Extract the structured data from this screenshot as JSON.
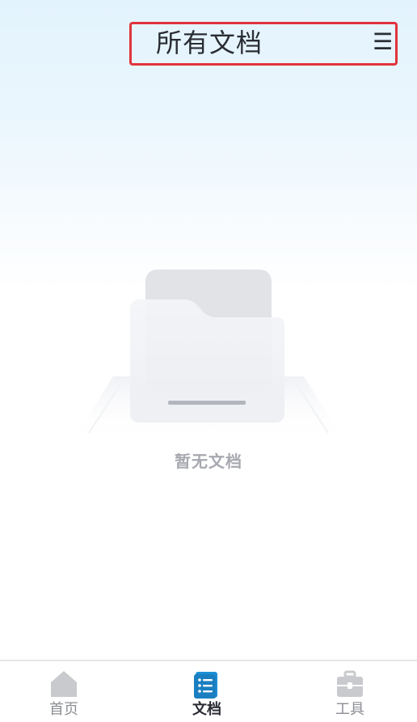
{
  "header": {
    "title": "所有文档",
    "menu_glyph": "☰"
  },
  "empty_state": {
    "message": "暂无文档",
    "icon": "empty-folder-icon"
  },
  "tabbar": {
    "tabs": [
      {
        "label": "首页",
        "icon": "home-icon",
        "active": false
      },
      {
        "label": "文档",
        "icon": "document-list-icon",
        "active": true
      },
      {
        "label": "工具",
        "icon": "toolbox-icon",
        "active": false
      }
    ]
  },
  "colors": {
    "accent": "#1c8fd6",
    "inactive_icon": "#c9cacd",
    "highlight_border": "#e0343d"
  }
}
